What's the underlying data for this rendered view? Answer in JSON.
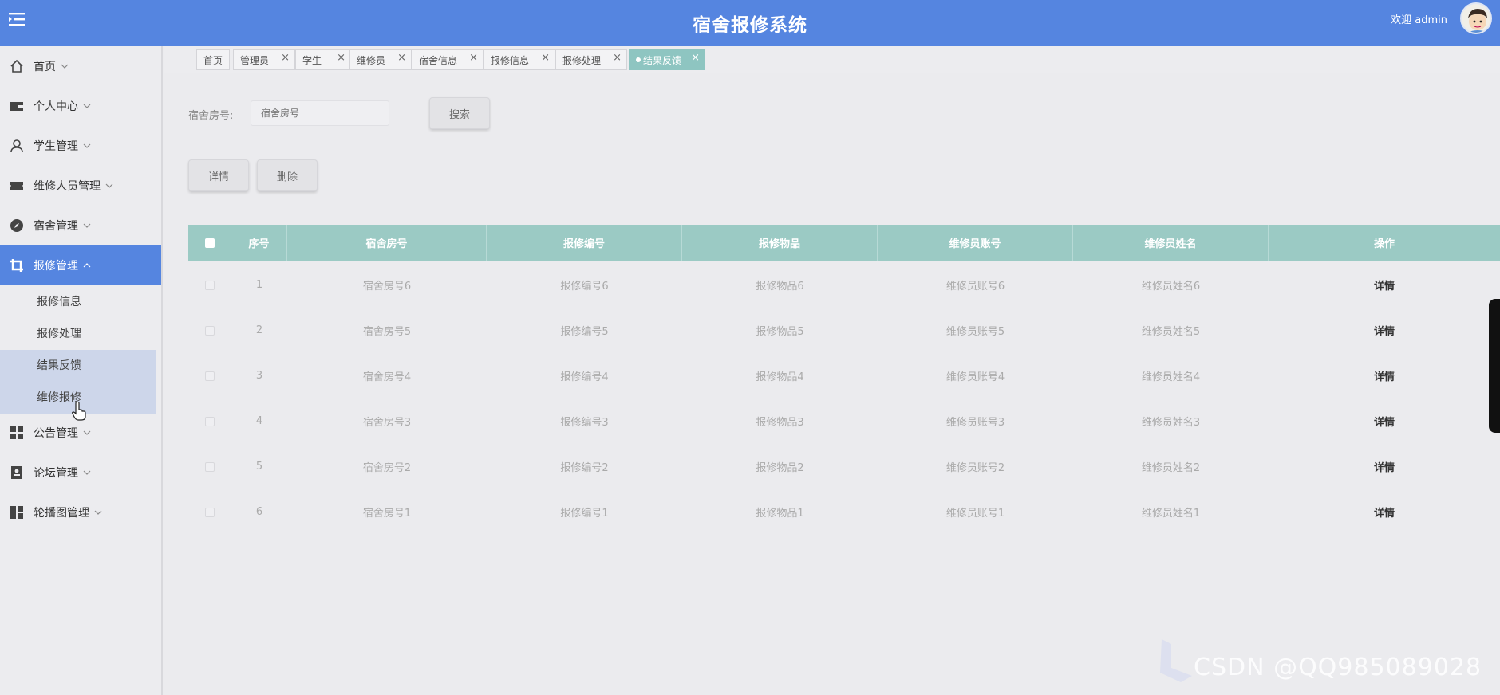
{
  "header": {
    "title": "宿舍报修系统",
    "welcome": "欢迎 admin"
  },
  "sidebar": {
    "items": [
      {
        "label": "首页",
        "icon": "home-icon"
      },
      {
        "label": "个人中心",
        "icon": "wallet-icon"
      },
      {
        "label": "学生管理",
        "icon": "user-icon"
      },
      {
        "label": "维修人员管理",
        "icon": "ticket-icon"
      },
      {
        "label": "宿舍管理",
        "icon": "compass-icon"
      },
      {
        "label": "报修管理",
        "icon": "crop-icon"
      },
      {
        "label": "公告管理",
        "icon": "grid-icon"
      },
      {
        "label": "论坛管理",
        "icon": "id-card-icon"
      },
      {
        "label": "轮播图管理",
        "icon": "layout-icon"
      }
    ],
    "sub_items": [
      "报修信息",
      "报修处理",
      "结果反馈",
      "维修报修"
    ]
  },
  "tabs": [
    "首页",
    "管理员",
    "学生",
    "维修员",
    "宿舍信息",
    "报修信息",
    "报修处理",
    "结果反馈"
  ],
  "search": {
    "label": "宿舍房号:",
    "placeholder": "宿舍房号",
    "button": "搜索"
  },
  "actions": {
    "detail": "详情",
    "delete": "删除"
  },
  "table": {
    "headers": [
      "序号",
      "宿舍房号",
      "报修编号",
      "报修物品",
      "维修员账号",
      "维修员姓名",
      "操作"
    ],
    "rows": [
      [
        "1",
        "宿舍房号6",
        "报修编号6",
        "报修物品6",
        "维修员账号6",
        "维修员姓名6",
        "详情"
      ],
      [
        "2",
        "宿舍房号5",
        "报修编号5",
        "报修物品5",
        "维修员账号5",
        "维修员姓名5",
        "详情"
      ],
      [
        "3",
        "宿舍房号4",
        "报修编号4",
        "报修物品4",
        "维修员账号4",
        "维修员姓名4",
        "详情"
      ],
      [
        "4",
        "宿舍房号3",
        "报修编号3",
        "报修物品3",
        "维修员账号3",
        "维修员姓名3",
        "详情"
      ],
      [
        "5",
        "宿舍房号2",
        "报修编号2",
        "报修物品2",
        "维修员账号2",
        "维修员姓名2",
        "详情"
      ],
      [
        "6",
        "宿舍房号1",
        "报修编号1",
        "报修物品1",
        "维修员账号1",
        "维修员姓名1",
        "详情"
      ]
    ]
  },
  "watermark": "CSDN @QQ985089028",
  "colors": {
    "header": "#5585e0",
    "table_header": "#9bcac4",
    "active_tab": "#8ec5c1"
  }
}
